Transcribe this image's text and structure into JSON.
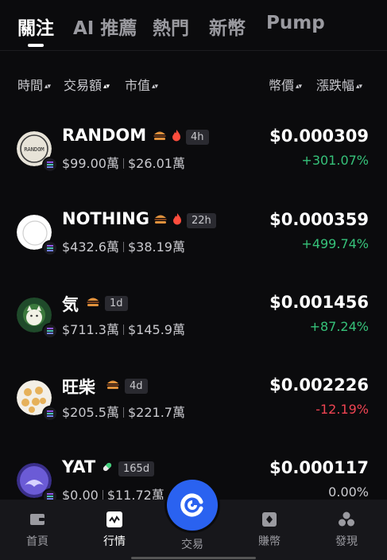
{
  "tabs": [
    {
      "label": "關注",
      "active": true
    },
    {
      "label": "AI 推薦",
      "active": false
    },
    {
      "label": "熱門",
      "active": false
    },
    {
      "label": "新幣",
      "active": false
    },
    {
      "label": "Pump",
      "active": false
    }
  ],
  "sort_headers": {
    "time": "時間",
    "volume": "交易額",
    "market_cap": "市值",
    "price": "幣價",
    "change": "漲跌幅"
  },
  "tokens": [
    {
      "name": "RANDOM",
      "age": "4h",
      "volume": "$99.00萬",
      "market_cap": "$26.01萬",
      "price": "$0.000309",
      "change": "+301.07%",
      "trend": "up",
      "badges": [
        "burger-icon",
        "flame-icon"
      ]
    },
    {
      "name": "NOTHING",
      "age": "22h",
      "volume": "$432.6萬",
      "market_cap": "$38.19萬",
      "price": "$0.000359",
      "change": "+499.74%",
      "trend": "up",
      "badges": [
        "burger-icon",
        "flame-icon"
      ]
    },
    {
      "name": "気",
      "age": "1d",
      "volume": "$711.3萬",
      "market_cap": "$145.9萬",
      "price": "$0.001456",
      "change": "+87.24%",
      "trend": "up",
      "badges": [
        "burger-icon"
      ]
    },
    {
      "name": "旺柴",
      "age": "4d",
      "volume": "$205.5萬",
      "market_cap": "$221.7萬",
      "price": "$0.002226",
      "change": "-12.19%",
      "trend": "down",
      "badges": [
        "burger-icon"
      ]
    },
    {
      "name": "YAT",
      "age": "165d",
      "volume": "$0.00",
      "market_cap": "$11.72萬",
      "price": "$0.000117",
      "change": "0.00%",
      "trend": "flat",
      "badges": [
        "pill-icon"
      ]
    }
  ],
  "avatar_text": {
    "random": "RANDOM"
  },
  "bottom_nav": {
    "home": "首頁",
    "market": "行情",
    "trade": "交易",
    "earn": "賺幣",
    "discover": "發現"
  },
  "colors": {
    "up": "#36c27a",
    "down": "#ef4452",
    "accent": "#2a62f0",
    "background": "#0b0b0d"
  }
}
